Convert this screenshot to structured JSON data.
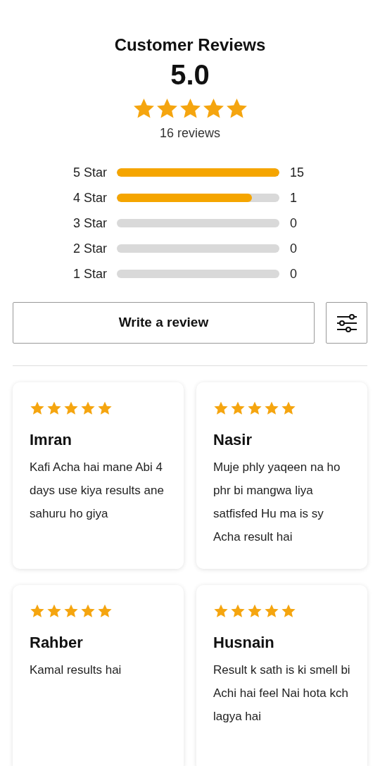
{
  "summary": {
    "title": "Customer Reviews",
    "average": "5.0",
    "stars": 5,
    "count": "16 reviews"
  },
  "breakdown": [
    {
      "label": "5 Star",
      "level": 1.0,
      "count": "15"
    },
    {
      "label": "4 Star",
      "level": 0.83,
      "count": "1"
    },
    {
      "label": "3 Star",
      "level": 0,
      "count": "0"
    },
    {
      "label": "2 Star",
      "level": 0,
      "count": "0"
    },
    {
      "label": "1 Star",
      "level": 0,
      "count": "0"
    }
  ],
  "write_button": "Write a review",
  "reviews": [
    {
      "stars": 5,
      "name": "Imran",
      "text": "Kafi Acha hai mane Abi 4 days use kiya results ane sahuru ho giya"
    },
    {
      "stars": 5,
      "name": "Nasir",
      "text": "Muje phly yaqeen na ho phr bi mangwa liya satfisfed Hu ma is sy Acha result hai"
    },
    {
      "stars": 5,
      "name": "Rahber",
      "text": "Kamal results hai"
    },
    {
      "stars": 5,
      "name": "Husnain",
      "text": "Result k sath is ki smell bi Achi hai feel Nai hota kch lagya hai"
    }
  ]
}
